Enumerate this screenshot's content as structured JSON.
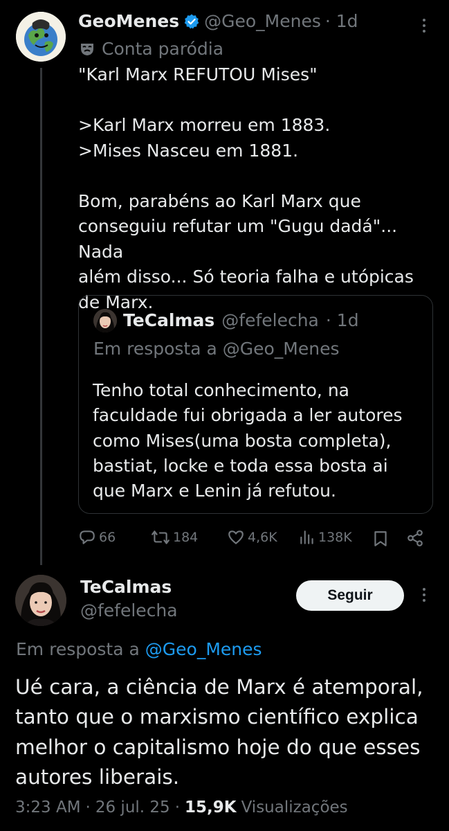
{
  "main_tweet": {
    "author_name": "GeoMenes",
    "handle": "@Geo_Menes",
    "time": "· 1d",
    "label": "Conta paródia",
    "text": "\"Karl Marx REFUTOU Mises\"\n\n>Karl Marx morreu em 1883.\n>Mises Nasceu em 1881.\n\nBom, parabéns ao Karl Marx que\nconseguiu refutar um \"Gugu dadá\"... Nada\nalém disso... Só teoria falha e utópicas\nde Marx.",
    "quote": {
      "author_name": "TeCalmas",
      "handle": "@fefelecha",
      "time": "· 1d",
      "reply_to": "Em resposta a @Geo_Menes",
      "text": "Tenho total conhecimento, na\nfaculdade fui obrigada a ler autores\ncomo Mises(uma bosta completa),\nbastiat, locke e toda essa bosta ai\nque Marx e Lenin já refutou."
    },
    "actions": {
      "replies": "66",
      "reposts": "184",
      "likes": "4,6K",
      "views": "138K"
    }
  },
  "reply_tweet": {
    "author_name": "TeCalmas",
    "handle": "@fefelecha",
    "follow_label": "Seguir",
    "reply_prefix": "Em resposta a",
    "reply_handle": "@Geo_Menes",
    "text": "Ué cara, a ciência de Marx é atemporal,\ntanto que o marxismo científico explica\nmelhor o capitalismo hoje do que esses\nautores liberais.",
    "time": "3:23 AM",
    "date": "26 jul. 25",
    "views_count": "15,9K",
    "views_label": "Visualizações",
    "separator": "·"
  },
  "colors": {
    "background": "#000000",
    "text": "#e7e9ea",
    "muted": "#71767b",
    "link": "#1d9bf0",
    "verified": "#1d9bf0",
    "border": "#2f3336"
  }
}
